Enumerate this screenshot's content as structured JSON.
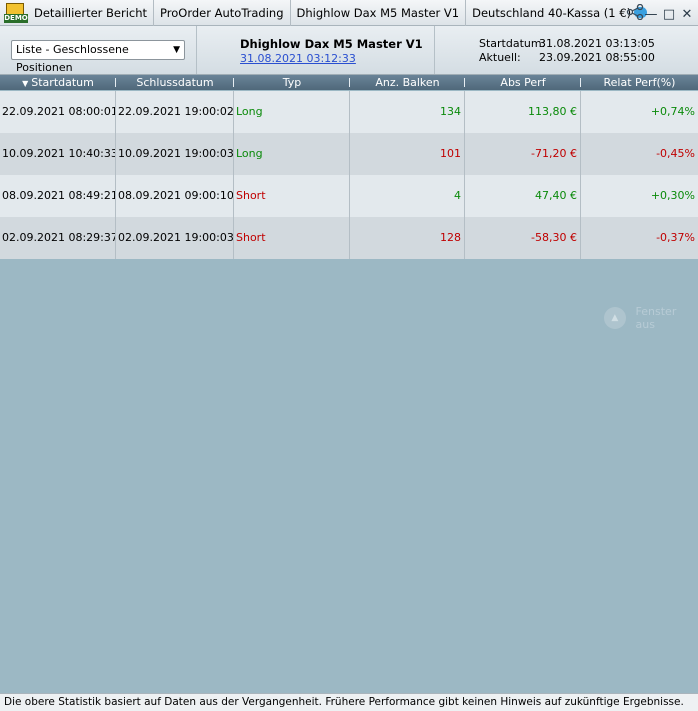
{
  "titlebar": {
    "demo_icon_text": "DEMO",
    "tabs": [
      {
        "label": "Detaillierter Bericht"
      },
      {
        "label": "ProOrder AutoTrading"
      },
      {
        "label": "Dhighlow Dax M5 Master V1"
      },
      {
        "label": "Deutschland 40-Kassa (1 €)"
      }
    ],
    "icons": [
      "share-icon",
      "minimize-icon",
      "maximize-icon",
      "close-icon"
    ]
  },
  "header": {
    "list_select": "Liste - Geschlossene Positionen",
    "system_title": "Dhighlow Dax M5 Master V1",
    "system_date": "31.08.2021 03:12:33",
    "start_label": "Startdatum:",
    "start_value": "31.08.2021 03:13:05",
    "current_label": "Aktuell:",
    "current_value": "23.09.2021 08:55:00"
  },
  "table": {
    "columns": [
      "Startdatum",
      "Schlussdatum",
      "Typ",
      "Anz. Balken",
      "Abs Perf",
      "Relat Perf(%)"
    ],
    "rows": [
      {
        "start": "22.09.2021 08:00:01",
        "end": "22.09.2021 19:00:02",
        "type": "Long",
        "bars": "134",
        "abs": "113,80 €",
        "rel": "+0,74%",
        "status": "win"
      },
      {
        "start": "10.09.2021 10:40:33",
        "end": "10.09.2021 19:00:03",
        "type": "Long",
        "bars": "101",
        "abs": "-71,20 €",
        "rel": "-0,45%",
        "status": "loss"
      },
      {
        "start": "08.09.2021 08:49:21",
        "end": "08.09.2021 09:00:10",
        "type": "Short",
        "bars": "4",
        "abs": "47,40 €",
        "rel": "+0,30%",
        "status": "win"
      },
      {
        "start": "02.09.2021 08:29:37",
        "end": "02.09.2021 19:00:03",
        "type": "Short",
        "bars": "128",
        "abs": "-58,30 €",
        "rel": "-0,37%",
        "status": "loss"
      }
    ]
  },
  "ghost_button": "Fenster aus",
  "status_text": "Die obere Statistik basiert auf Daten aus der Vergangenheit. Frühere Performance gibt keinen Hinweis auf zukünftige Ergebnisse.",
  "colors": {
    "long": "#0a8a0a",
    "short": "#c00000",
    "win": "#0a8a0a",
    "loss": "#c00000",
    "header_bg": "#4f687a",
    "body_bg": "#9cb8c4"
  }
}
